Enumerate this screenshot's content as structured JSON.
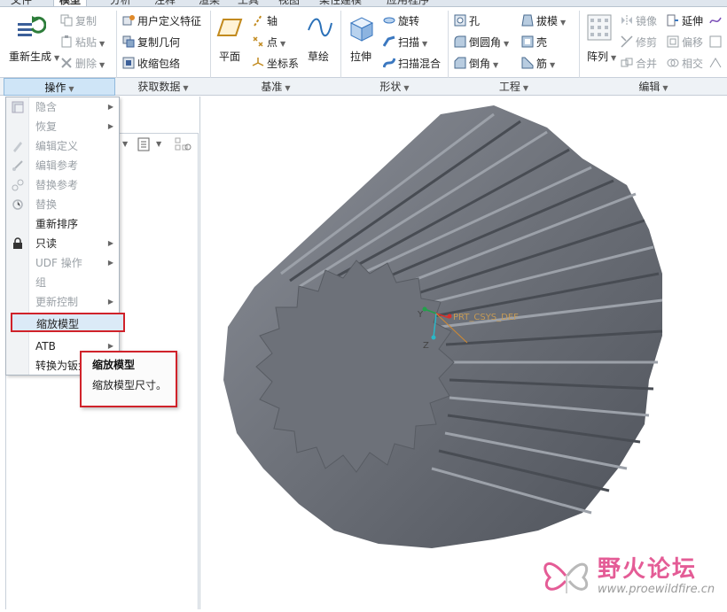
{
  "tabs": [
    "文件",
    "模型",
    "分析",
    "注释",
    "渲染",
    "工具",
    "视图",
    "柔性建模",
    "应用程序"
  ],
  "ribbon": {
    "operations": {
      "regenerate": "重新生成",
      "copy": "复制",
      "paste": "粘贴",
      "delete": "删除"
    },
    "get_data": {
      "user_defined_feature": "用户定义特征",
      "copy_geometry": "复制几何",
      "shrinkwrap": "收缩包络"
    },
    "datum": {
      "plane": "平面",
      "axis": "轴",
      "point": "点",
      "csys": "坐标系",
      "sketch": "草绘"
    },
    "shapes": {
      "extrude": "拉伸",
      "revolve": "旋转",
      "sweep": "扫描",
      "swept_blend": "扫描混合"
    },
    "engineering": {
      "hole": "孔",
      "round": "倒圆角",
      "chamfer": "倒角",
      "draft": "拔模",
      "shell": "壳",
      "rib": "筋"
    },
    "editing": {
      "pattern": "阵列",
      "mirror": "镜像",
      "trim": "修剪",
      "merge": "合并",
      "extend": "延伸",
      "offset": "偏移",
      "intersect": "相交"
    },
    "group_labels": [
      "操作",
      "获取数据",
      "基准",
      "形状",
      "工程",
      "编辑"
    ]
  },
  "menu": {
    "items": [
      {
        "label": "隐含",
        "disabled": true,
        "submenu": true
      },
      {
        "label": "恢复",
        "disabled": true,
        "submenu": true
      },
      {
        "label": "编辑定义",
        "disabled": true,
        "submenu": false
      },
      {
        "label": "编辑参考",
        "disabled": true,
        "submenu": false
      },
      {
        "label": "替换参考",
        "disabled": true,
        "submenu": false
      },
      {
        "label": "替换",
        "disabled": true,
        "submenu": false
      },
      {
        "label": "重新排序",
        "disabled": false,
        "submenu": false
      },
      {
        "label": "只读",
        "disabled": false,
        "submenu": true
      },
      {
        "label": "UDF 操作",
        "disabled": true,
        "submenu": true
      },
      {
        "label": "组",
        "disabled": true,
        "submenu": false
      },
      {
        "label": "更新控制",
        "disabled": true,
        "submenu": true
      },
      {
        "label": "缩放模型",
        "disabled": false,
        "submenu": false,
        "highlighted": true
      },
      {
        "label": "ATB",
        "disabled": false,
        "submenu": true
      },
      {
        "label": "转换为钣金件",
        "disabled": false,
        "submenu": false
      }
    ]
  },
  "tooltip": {
    "title": "缩放模型",
    "description": "缩放模型尺寸。"
  },
  "canvas": {
    "csys_label": "PRT_CSYS_DEF",
    "axis_y": "Y",
    "axis_z": "Z"
  },
  "watermark": {
    "title": "野火论坛",
    "url": "www.proewildfire.cn"
  },
  "colors": {
    "accent_red": "#d0222a",
    "gear_gray": "#6c7078",
    "watermark_pink": "#e45c96"
  }
}
